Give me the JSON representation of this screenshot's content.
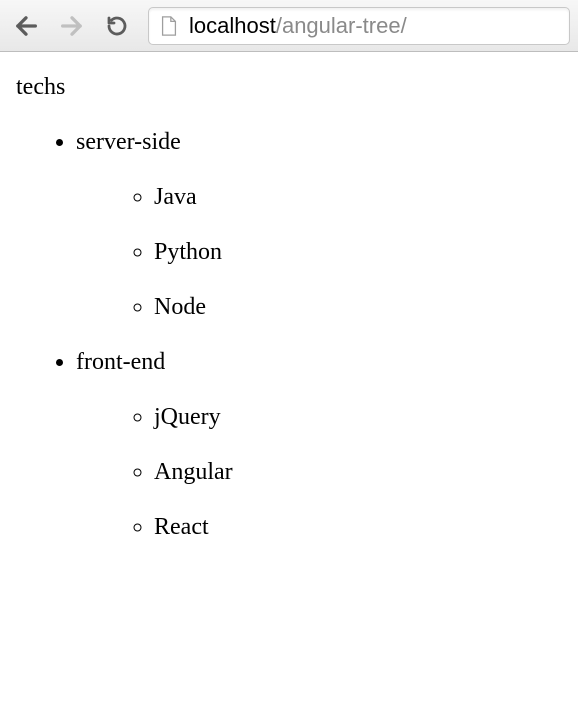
{
  "browser": {
    "url_host": "localhost",
    "url_path": "/angular-tree/"
  },
  "tree": {
    "root": {
      "label": "techs",
      "children": [
        {
          "label": "server-side",
          "children": [
            {
              "label": "Java"
            },
            {
              "label": "Python"
            },
            {
              "label": "Node"
            }
          ]
        },
        {
          "label": "front-end",
          "children": [
            {
              "label": "jQuery"
            },
            {
              "label": "Angular"
            },
            {
              "label": "React"
            }
          ]
        }
      ]
    }
  }
}
